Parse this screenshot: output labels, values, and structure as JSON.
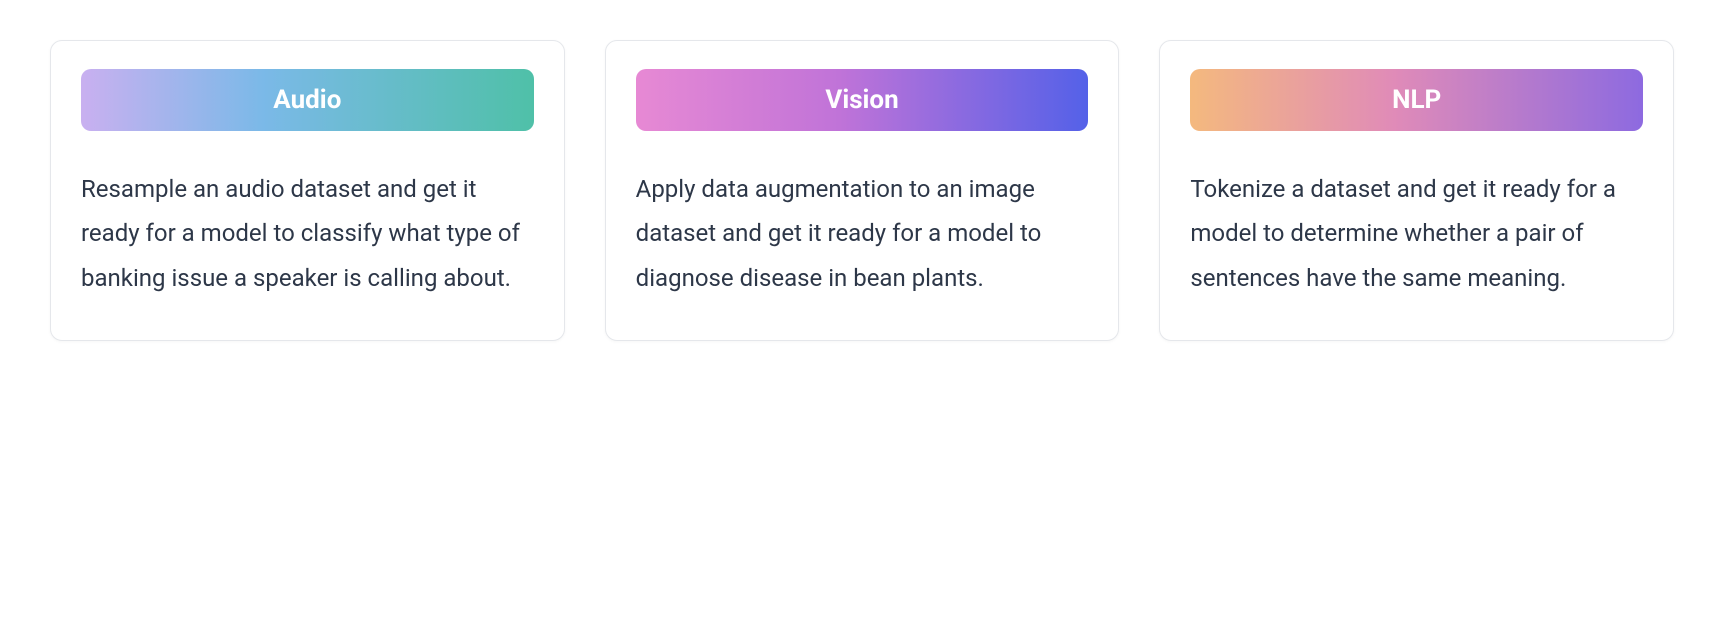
{
  "cards": [
    {
      "title": "Audio",
      "description": "Resample an audio dataset and get it ready for a model to classify what type of banking issue a speaker is calling about."
    },
    {
      "title": "Vision",
      "description": "Apply data augmentation to an image dataset and get it ready for a model to diagnose disease in bean plants."
    },
    {
      "title": "NLP",
      "description": "Tokenize a dataset and get it ready for a model to determine whether a pair of sentences have the same meaning."
    }
  ]
}
